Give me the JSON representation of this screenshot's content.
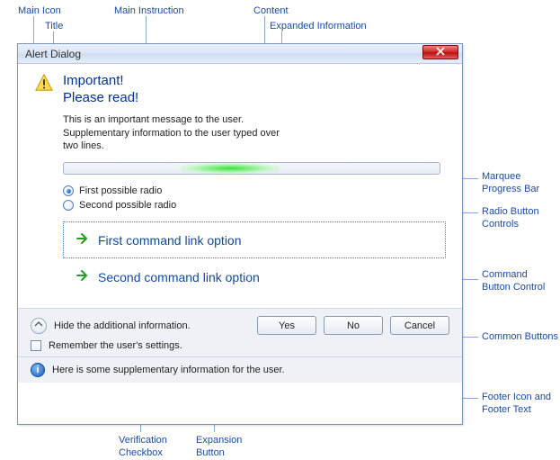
{
  "callouts": {
    "main_icon": "Main Icon",
    "title": "Title",
    "main_instruction": "Main Instruction",
    "content": "Content",
    "expanded_info": "Expanded Information",
    "marquee": "Marquee Progress Bar",
    "radio_controls": "Radio Button Controls",
    "command_button": "Command Button Control",
    "common_buttons": "Common Buttons",
    "footer": "Footer Icon and Footer Text",
    "verification": "Verification Checkbox",
    "expansion": "Expansion Button"
  },
  "dialog": {
    "title": "Alert Dialog",
    "main_instruction_1": "Important!",
    "main_instruction_2": "Please read!",
    "content": "This is an important message to the user.",
    "expanded": "Supplementary information to the user typed over two lines.",
    "radios": [
      {
        "label": "First possible radio",
        "checked": true
      },
      {
        "label": "Second possible radio",
        "checked": false
      }
    ],
    "commands": [
      {
        "label": "First command link option",
        "selected": true
      },
      {
        "label": "Second command link option",
        "selected": false
      }
    ],
    "expand_label": "Hide the additional information.",
    "verify_label": "Remember the user's settings.",
    "buttons": {
      "yes": "Yes",
      "no": "No",
      "cancel": "Cancel"
    },
    "footer_text": "Here is some supplementary information for the user."
  }
}
